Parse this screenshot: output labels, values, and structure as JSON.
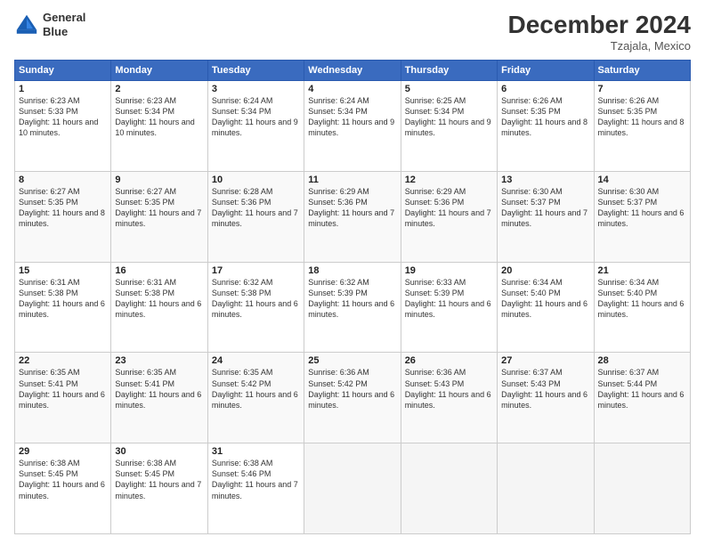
{
  "logo": {
    "line1": "General",
    "line2": "Blue"
  },
  "title": "December 2024",
  "location": "Tzajala, Mexico",
  "days_header": [
    "Sunday",
    "Monday",
    "Tuesday",
    "Wednesday",
    "Thursday",
    "Friday",
    "Saturday"
  ],
  "weeks": [
    [
      {
        "day": "1",
        "sunrise": "Sunrise: 6:23 AM",
        "sunset": "Sunset: 5:33 PM",
        "daylight": "Daylight: 11 hours and 10 minutes."
      },
      {
        "day": "2",
        "sunrise": "Sunrise: 6:23 AM",
        "sunset": "Sunset: 5:34 PM",
        "daylight": "Daylight: 11 hours and 10 minutes."
      },
      {
        "day": "3",
        "sunrise": "Sunrise: 6:24 AM",
        "sunset": "Sunset: 5:34 PM",
        "daylight": "Daylight: 11 hours and 9 minutes."
      },
      {
        "day": "4",
        "sunrise": "Sunrise: 6:24 AM",
        "sunset": "Sunset: 5:34 PM",
        "daylight": "Daylight: 11 hours and 9 minutes."
      },
      {
        "day": "5",
        "sunrise": "Sunrise: 6:25 AM",
        "sunset": "Sunset: 5:34 PM",
        "daylight": "Daylight: 11 hours and 9 minutes."
      },
      {
        "day": "6",
        "sunrise": "Sunrise: 6:26 AM",
        "sunset": "Sunset: 5:35 PM",
        "daylight": "Daylight: 11 hours and 8 minutes."
      },
      {
        "day": "7",
        "sunrise": "Sunrise: 6:26 AM",
        "sunset": "Sunset: 5:35 PM",
        "daylight": "Daylight: 11 hours and 8 minutes."
      }
    ],
    [
      {
        "day": "8",
        "sunrise": "Sunrise: 6:27 AM",
        "sunset": "Sunset: 5:35 PM",
        "daylight": "Daylight: 11 hours and 8 minutes."
      },
      {
        "day": "9",
        "sunrise": "Sunrise: 6:27 AM",
        "sunset": "Sunset: 5:35 PM",
        "daylight": "Daylight: 11 hours and 7 minutes."
      },
      {
        "day": "10",
        "sunrise": "Sunrise: 6:28 AM",
        "sunset": "Sunset: 5:36 PM",
        "daylight": "Daylight: 11 hours and 7 minutes."
      },
      {
        "day": "11",
        "sunrise": "Sunrise: 6:29 AM",
        "sunset": "Sunset: 5:36 PM",
        "daylight": "Daylight: 11 hours and 7 minutes."
      },
      {
        "day": "12",
        "sunrise": "Sunrise: 6:29 AM",
        "sunset": "Sunset: 5:36 PM",
        "daylight": "Daylight: 11 hours and 7 minutes."
      },
      {
        "day": "13",
        "sunrise": "Sunrise: 6:30 AM",
        "sunset": "Sunset: 5:37 PM",
        "daylight": "Daylight: 11 hours and 7 minutes."
      },
      {
        "day": "14",
        "sunrise": "Sunrise: 6:30 AM",
        "sunset": "Sunset: 5:37 PM",
        "daylight": "Daylight: 11 hours and 6 minutes."
      }
    ],
    [
      {
        "day": "15",
        "sunrise": "Sunrise: 6:31 AM",
        "sunset": "Sunset: 5:38 PM",
        "daylight": "Daylight: 11 hours and 6 minutes."
      },
      {
        "day": "16",
        "sunrise": "Sunrise: 6:31 AM",
        "sunset": "Sunset: 5:38 PM",
        "daylight": "Daylight: 11 hours and 6 minutes."
      },
      {
        "day": "17",
        "sunrise": "Sunrise: 6:32 AM",
        "sunset": "Sunset: 5:38 PM",
        "daylight": "Daylight: 11 hours and 6 minutes."
      },
      {
        "day": "18",
        "sunrise": "Sunrise: 6:32 AM",
        "sunset": "Sunset: 5:39 PM",
        "daylight": "Daylight: 11 hours and 6 minutes."
      },
      {
        "day": "19",
        "sunrise": "Sunrise: 6:33 AM",
        "sunset": "Sunset: 5:39 PM",
        "daylight": "Daylight: 11 hours and 6 minutes."
      },
      {
        "day": "20",
        "sunrise": "Sunrise: 6:34 AM",
        "sunset": "Sunset: 5:40 PM",
        "daylight": "Daylight: 11 hours and 6 minutes."
      },
      {
        "day": "21",
        "sunrise": "Sunrise: 6:34 AM",
        "sunset": "Sunset: 5:40 PM",
        "daylight": "Daylight: 11 hours and 6 minutes."
      }
    ],
    [
      {
        "day": "22",
        "sunrise": "Sunrise: 6:35 AM",
        "sunset": "Sunset: 5:41 PM",
        "daylight": "Daylight: 11 hours and 6 minutes."
      },
      {
        "day": "23",
        "sunrise": "Sunrise: 6:35 AM",
        "sunset": "Sunset: 5:41 PM",
        "daylight": "Daylight: 11 hours and 6 minutes."
      },
      {
        "day": "24",
        "sunrise": "Sunrise: 6:35 AM",
        "sunset": "Sunset: 5:42 PM",
        "daylight": "Daylight: 11 hours and 6 minutes."
      },
      {
        "day": "25",
        "sunrise": "Sunrise: 6:36 AM",
        "sunset": "Sunset: 5:42 PM",
        "daylight": "Daylight: 11 hours and 6 minutes."
      },
      {
        "day": "26",
        "sunrise": "Sunrise: 6:36 AM",
        "sunset": "Sunset: 5:43 PM",
        "daylight": "Daylight: 11 hours and 6 minutes."
      },
      {
        "day": "27",
        "sunrise": "Sunrise: 6:37 AM",
        "sunset": "Sunset: 5:43 PM",
        "daylight": "Daylight: 11 hours and 6 minutes."
      },
      {
        "day": "28",
        "sunrise": "Sunrise: 6:37 AM",
        "sunset": "Sunset: 5:44 PM",
        "daylight": "Daylight: 11 hours and 6 minutes."
      }
    ],
    [
      {
        "day": "29",
        "sunrise": "Sunrise: 6:38 AM",
        "sunset": "Sunset: 5:45 PM",
        "daylight": "Daylight: 11 hours and 6 minutes."
      },
      {
        "day": "30",
        "sunrise": "Sunrise: 6:38 AM",
        "sunset": "Sunset: 5:45 PM",
        "daylight": "Daylight: 11 hours and 7 minutes."
      },
      {
        "day": "31",
        "sunrise": "Sunrise: 6:38 AM",
        "sunset": "Sunset: 5:46 PM",
        "daylight": "Daylight: 11 hours and 7 minutes."
      },
      null,
      null,
      null,
      null
    ]
  ]
}
